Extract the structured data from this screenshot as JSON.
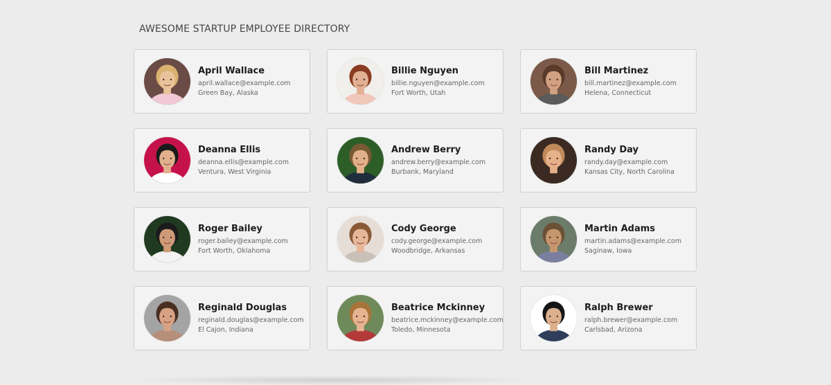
{
  "header": {
    "title": "AWESOME STARTUP EMPLOYEE DIRECTORY"
  },
  "employees": [
    {
      "name": "April Wallace",
      "email": "april.wallace@example.com",
      "location": "Green Bay, Alaska",
      "skin": "#e8c29a",
      "hair": "#d9b170",
      "bg": "#6b4b45",
      "shirt": "#f2c7d6"
    },
    {
      "name": "Billie Nguyen",
      "email": "billie.nguyen@example.com",
      "location": "Fort Worth, Utah",
      "skin": "#e2b093",
      "hair": "#8a3c22",
      "bg": "#f1efec",
      "shirt": "#f0c7b9"
    },
    {
      "name": "Bill Martinez",
      "email": "bill.martinez@example.com",
      "location": "Helena, Connecticut",
      "skin": "#d1a181",
      "hair": "#5a3a2a",
      "bg": "#7b5a4a",
      "shirt": "#5b5b5b"
    },
    {
      "name": "Deanna Ellis",
      "email": "deanna.ellis@example.com",
      "location": "Ventura, West Virginia",
      "skin": "#e2b08d",
      "hair": "#1a1a1a",
      "bg": "#c6124c",
      "shirt": "#ffffff"
    },
    {
      "name": "Andrew Berry",
      "email": "andrew.berry@example.com",
      "location": "Burbank, Maryland",
      "skin": "#e1b08a",
      "hair": "#7a5a33",
      "bg": "#2e5e28",
      "shirt": "#1f2d3c"
    },
    {
      "name": "Randy Day",
      "email": "randy.day@example.com",
      "location": "Kansas City, North Carolina",
      "skin": "#e6b08a",
      "hair": "#c08a5a",
      "bg": "#3a2a22",
      "shirt": "#3b2a22"
    },
    {
      "name": "Roger Bailey",
      "email": "roger.bailey@example.com",
      "location": "Fort Worth, Oklahoma",
      "skin": "#cf9a78",
      "hair": "#1b1b1b",
      "bg": "#1f3a20",
      "shirt": "#f2f2f2"
    },
    {
      "name": "Cody George",
      "email": "cody.george@example.com",
      "location": "Woodbridge, Arkansas",
      "skin": "#e7b79a",
      "hair": "#8a5a36",
      "bg": "#e6ddd6",
      "shirt": "#c9c1b8"
    },
    {
      "name": "Martin Adams",
      "email": "martin.adams@example.com",
      "location": "Saginaw, Iowa",
      "skin": "#c6976f",
      "hair": "#6b5136",
      "bg": "#6c7c6a",
      "shirt": "#7a7fa0"
    },
    {
      "name": "Reginald Douglas",
      "email": "reginald.douglas@example.com",
      "location": "El Cajon, Indiana",
      "skin": "#d7a183",
      "hair": "#4a2e22",
      "bg": "#a4a4a4",
      "shirt": "#b58f7a"
    },
    {
      "name": "Beatrice Mckinney",
      "email": "beatrice.mckinney@example.com",
      "location": "Toledo, Minnesota",
      "skin": "#e7b492",
      "hair": "#a7753a",
      "bg": "#6e8a5a",
      "shirt": "#b43a3a"
    },
    {
      "name": "Ralph Brewer",
      "email": "ralph.brewer@example.com",
      "location": "Carlsbad, Arizona",
      "skin": "#dcb08d",
      "hair": "#151515",
      "bg": "#ffffff",
      "shirt": "#2e3e5a"
    }
  ]
}
